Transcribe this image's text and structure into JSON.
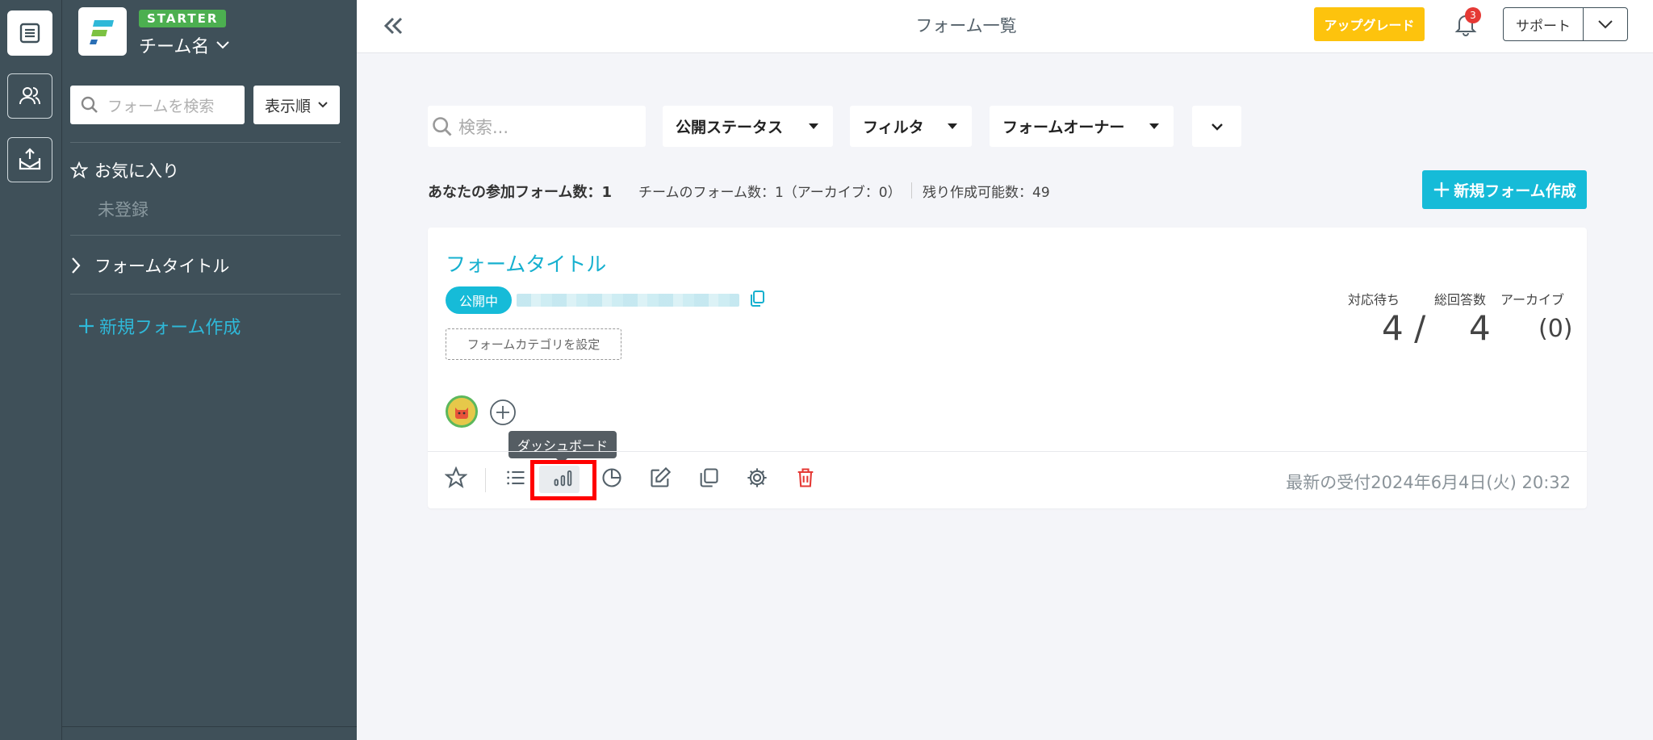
{
  "app": {
    "title": "フォーム一覧"
  },
  "rail": {
    "items": [
      "forms-icon",
      "users-icon",
      "inbox-icon"
    ]
  },
  "sidebar": {
    "plan_badge": "STARTER",
    "team_name": "チーム名",
    "search_placeholder": "フォームを検索",
    "sort_label": "表示順",
    "favorites_label": "お気に入り",
    "favorites_empty": "未登録",
    "form_item": "フォームタイトル",
    "new_form": "新規フォーム作成"
  },
  "topbar": {
    "upgrade_label": "アップグレード",
    "notification_count": "3",
    "support_label": "サポート"
  },
  "filters": {
    "search_placeholder": "検索...",
    "status_label": "公開ステータス",
    "filter_label": "フィルタ",
    "owner_label": "フォームオーナー"
  },
  "stats": {
    "joined": "あなたの参加フォーム数：1",
    "team": "チームのフォーム数：1（アーカイブ：0）",
    "remaining": "残り作成可能数：49",
    "new_form_button": "新規フォーム作成"
  },
  "card": {
    "title": "フォームタイトル",
    "status_badge": "公開中",
    "category_button": "フォームカテゴリを設定",
    "pending_label": "対応待ち",
    "pending_value": "4 /",
    "total_label": "総回答数",
    "total_value": "4",
    "archive_label": "アーカイブ",
    "archive_value": "(0)",
    "tooltip": "ダッシュボード",
    "latest": "最新の受付2024年6月4日(火) 20:32"
  },
  "colors": {
    "sidebar_bg": "#3f5059",
    "accent": "#16bbd8",
    "upgrade": "#fdc30d",
    "delete": "#e53935",
    "highlight": "#ff0000"
  }
}
